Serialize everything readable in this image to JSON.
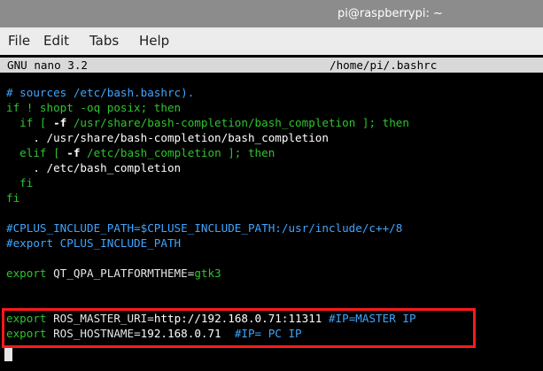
{
  "window": {
    "title": "pi@raspberrypi: ~"
  },
  "menu": {
    "items": [
      "File",
      "Edit",
      "Tabs",
      "Help"
    ]
  },
  "nano": {
    "version": "GNU nano 3.2",
    "filename": "/home/pi/.bashrc"
  },
  "lines": [
    {
      "segments": [
        {
          "text": "# sources /etc/bash.bashrc).",
          "style": "cmt"
        }
      ]
    },
    {
      "segments": [
        {
          "text": "if ! shopt -oq posix; then",
          "style": "kw"
        }
      ]
    },
    {
      "segments": [
        {
          "text": "  if [ ",
          "style": "kw"
        },
        {
          "text": "-f",
          "style": "bold"
        },
        {
          "text": " /usr/share/bash-completion/bash_completion ]; then",
          "style": "kw"
        }
      ]
    },
    {
      "segments": [
        {
          "text": "    . /usr/share/bash-completion/bash_completion",
          "style": "white"
        }
      ]
    },
    {
      "segments": [
        {
          "text": "  elif [ ",
          "style": "kw"
        },
        {
          "text": "-f",
          "style": "bold"
        },
        {
          "text": " /etc/bash_completion ]; then",
          "style": "kw"
        }
      ]
    },
    {
      "segments": [
        {
          "text": "    . /etc/bash_completion",
          "style": "white"
        }
      ]
    },
    {
      "segments": [
        {
          "text": "  fi",
          "style": "kw"
        }
      ]
    },
    {
      "segments": [
        {
          "text": "fi",
          "style": "kw"
        }
      ]
    },
    {
      "segments": [
        {
          "text": "",
          "style": "white"
        }
      ]
    },
    {
      "segments": [
        {
          "text": "#CPLUS_INCLUDE_PATH=$CPLUSE_INCLUDE_PATH:/usr/include/c++/8",
          "style": "cmt"
        }
      ]
    },
    {
      "segments": [
        {
          "text": "#export CPLUS_INCLUDE_PATH",
          "style": "cmt"
        }
      ]
    },
    {
      "segments": [
        {
          "text": "",
          "style": "white"
        }
      ]
    },
    {
      "segments": [
        {
          "text": "export",
          "style": "kw"
        },
        {
          "text": " QT_QPA_PLATFORMTHEME=",
          "style": "ev"
        },
        {
          "text": "gtk3",
          "style": "kw"
        }
      ]
    },
    {
      "segments": [
        {
          "text": "",
          "style": "white"
        }
      ]
    },
    {
      "segments": [
        {
          "text": "",
          "style": "white"
        }
      ]
    },
    {
      "segments": [
        {
          "text": "export",
          "style": "kw"
        },
        {
          "text": " ROS_MASTER_URI=",
          "style": "ev"
        },
        {
          "text": "http://192.168.0.71:11311 ",
          "style": "white"
        },
        {
          "text": "#IP=MASTER IP",
          "style": "cmt"
        }
      ]
    },
    {
      "segments": [
        {
          "text": "export",
          "style": "kw"
        },
        {
          "text": " ROS_HOSTNAME=",
          "style": "ev"
        },
        {
          "text": "192.168.0.71  ",
          "style": "white"
        },
        {
          "text": "#IP= PC IP",
          "style": "cmt"
        }
      ]
    }
  ],
  "colors": {
    "comment": "#3fa5ff",
    "keyword": "#2ec52e",
    "highlight_border": "#ff1a1a",
    "titlebar": "#8c8c8c",
    "menubar": "#ececec"
  }
}
